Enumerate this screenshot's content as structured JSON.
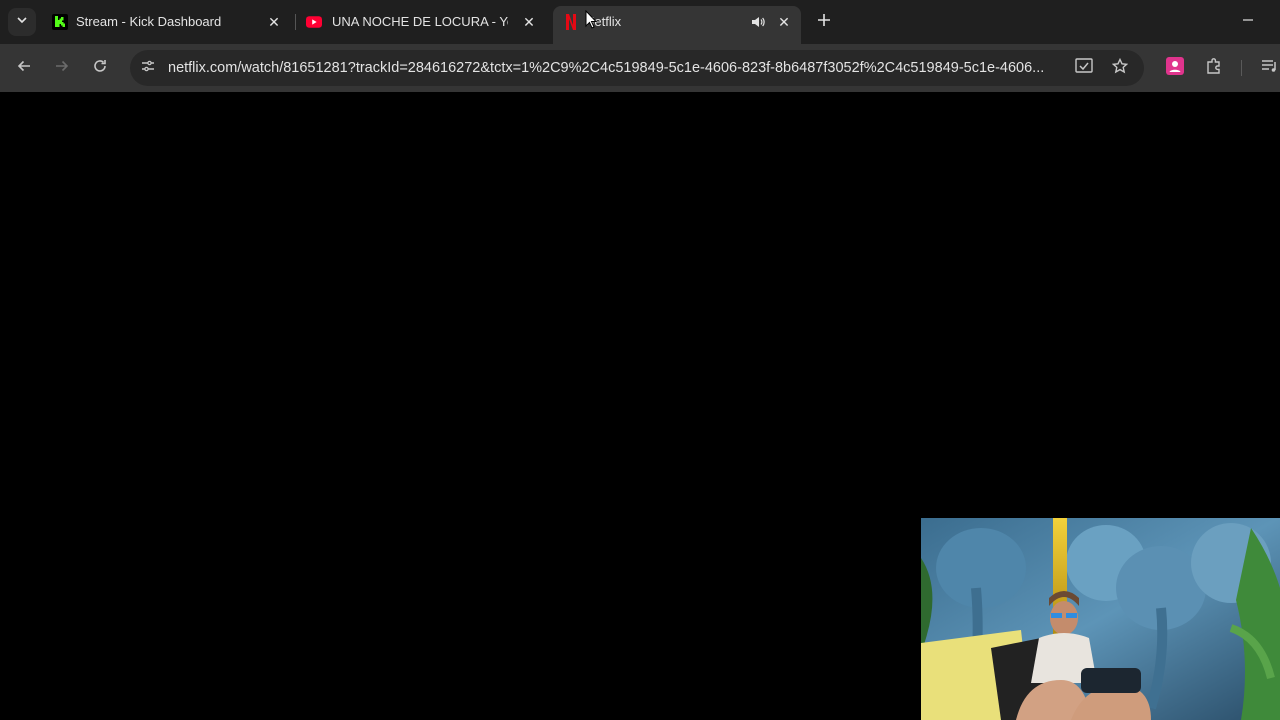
{
  "browser": {
    "tabs": [
      {
        "title": "Stream - Kick Dashboard",
        "favicon": "kick-icon",
        "active": false
      },
      {
        "title": "UNA NOCHE DE LOCURA - You",
        "favicon": "youtube-icon",
        "active": false
      },
      {
        "title": "Netflix",
        "favicon": "netflix-icon",
        "active": true,
        "audio": "speaker-icon"
      }
    ],
    "url": "netflix.com/watch/81651281?trackId=284616272&tctx=1%2C9%2C4c519849-5c1e-4606-823f-8b6487f3052f%2C4c519849-5c1e-4606...",
    "colors": {
      "tabstrip_bg": "#1f1f1f",
      "toolbar_bg": "#353535",
      "kick_green": "#53fc18",
      "youtube_red": "#ff0033",
      "netflix_red": "#e50914",
      "profile_pink": "#e0348d"
    }
  },
  "page": {
    "background": "#000000",
    "overlay": "webcam-overlay"
  }
}
